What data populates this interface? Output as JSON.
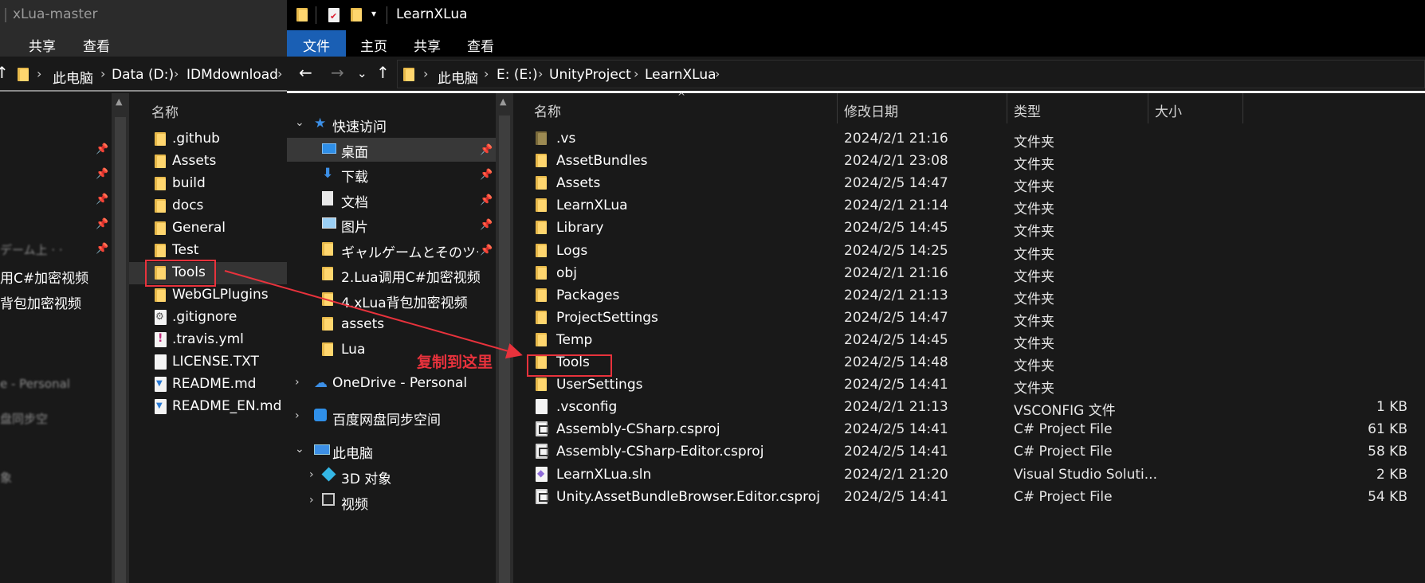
{
  "left_window": {
    "title": "xLua-master",
    "ribbon_tabs": [
      "共享",
      "查看"
    ],
    "address_crumbs": [
      "此电脑",
      "Data (D:)",
      "IDMdownload"
    ],
    "nav_fragments": [
      "用C#加密视频",
      "背包加密视频"
    ],
    "column_name": "名称",
    "items": [
      {
        "name": ".github",
        "kind": "folder"
      },
      {
        "name": "Assets",
        "kind": "folder"
      },
      {
        "name": "build",
        "kind": "folder"
      },
      {
        "name": "docs",
        "kind": "folder"
      },
      {
        "name": "General",
        "kind": "folder"
      },
      {
        "name": "Test",
        "kind": "folder"
      },
      {
        "name": "Tools",
        "kind": "folder"
      },
      {
        "name": "WebGLPlugins",
        "kind": "folder"
      },
      {
        "name": ".gitignore",
        "kind": "git"
      },
      {
        "name": ".travis.yml",
        "kind": "yml"
      },
      {
        "name": "LICENSE.TXT",
        "kind": "file"
      },
      {
        "name": "README.md",
        "kind": "md"
      },
      {
        "name": "README_EN.md",
        "kind": "md"
      }
    ]
  },
  "main_window": {
    "title": "LearnXLua",
    "ribbon_tabs": [
      "文件",
      "主页",
      "共享",
      "查看"
    ],
    "address_crumbs": [
      "此电脑",
      "E: (E:)",
      "UnityProject",
      "LearnXLua"
    ],
    "nav": [
      {
        "label": "快速访问",
        "icon": "star-icon",
        "level": 0,
        "expanded": true
      },
      {
        "label": "桌面",
        "icon": "desktop-icon",
        "level": 1,
        "pinned": true,
        "selected": true
      },
      {
        "label": "下载",
        "icon": "download-icon",
        "level": 1,
        "pinned": true
      },
      {
        "label": "文档",
        "icon": "document-icon",
        "level": 1,
        "pinned": true
      },
      {
        "label": "图片",
        "icon": "picture-icon",
        "level": 1,
        "pinned": true
      },
      {
        "label": "ギャルゲームとそのツー",
        "icon": "folder-icon",
        "level": 1,
        "pinned": true
      },
      {
        "label": "2.Lua调用C#加密视频",
        "icon": "folder-icon",
        "level": 1
      },
      {
        "label": "4.xLua背包加密视频",
        "icon": "folder-icon",
        "level": 1
      },
      {
        "label": "assets",
        "icon": "folder-icon",
        "level": 1
      },
      {
        "label": "Lua",
        "icon": "folder-icon",
        "level": 1
      },
      {
        "label": "OneDrive - Personal",
        "icon": "cloud-icon",
        "level": 0,
        "expanded": false
      },
      {
        "label": "百度网盘同步空间",
        "icon": "baidu-icon",
        "level": 0,
        "expanded": false
      },
      {
        "label": "此电脑",
        "icon": "computer-icon",
        "level": 0,
        "expanded": true
      },
      {
        "label": "3D 对象",
        "icon": "cube-icon",
        "level": 1,
        "expanded": false
      },
      {
        "label": "视频",
        "icon": "video-icon",
        "level": 1,
        "expanded": false
      }
    ],
    "columns": {
      "name": "名称",
      "date": "修改日期",
      "type": "类型",
      "size": "大小"
    },
    "files": [
      {
        "name": ".vs",
        "date": "2024/2/1 21:16",
        "type": "文件夹",
        "size": "",
        "kind": "folder-dark"
      },
      {
        "name": "AssetBundles",
        "date": "2024/2/1 23:08",
        "type": "文件夹",
        "size": "",
        "kind": "folder"
      },
      {
        "name": "Assets",
        "date": "2024/2/5 14:47",
        "type": "文件夹",
        "size": "",
        "kind": "folder"
      },
      {
        "name": "LearnXLua",
        "date": "2024/2/1 21:14",
        "type": "文件夹",
        "size": "",
        "kind": "folder"
      },
      {
        "name": "Library",
        "date": "2024/2/5 14:45",
        "type": "文件夹",
        "size": "",
        "kind": "folder"
      },
      {
        "name": "Logs",
        "date": "2024/2/5 14:25",
        "type": "文件夹",
        "size": "",
        "kind": "folder"
      },
      {
        "name": "obj",
        "date": "2024/2/1 21:16",
        "type": "文件夹",
        "size": "",
        "kind": "folder"
      },
      {
        "name": "Packages",
        "date": "2024/2/1 21:13",
        "type": "文件夹",
        "size": "",
        "kind": "folder"
      },
      {
        "name": "ProjectSettings",
        "date": "2024/2/5 14:47",
        "type": "文件夹",
        "size": "",
        "kind": "folder"
      },
      {
        "name": "Temp",
        "date": "2024/2/5 14:45",
        "type": "文件夹",
        "size": "",
        "kind": "folder"
      },
      {
        "name": "Tools",
        "date": "2024/2/5 14:48",
        "type": "文件夹",
        "size": "",
        "kind": "folder"
      },
      {
        "name": "UserSettings",
        "date": "2024/2/5 14:41",
        "type": "文件夹",
        "size": "",
        "kind": "folder"
      },
      {
        "name": ".vsconfig",
        "date": "2024/2/1 21:13",
        "type": "VSCONFIG 文件",
        "size": "1 KB",
        "kind": "file"
      },
      {
        "name": "Assembly-CSharp.csproj",
        "date": "2024/2/5 14:41",
        "type": "C# Project File",
        "size": "61 KB",
        "kind": "proj"
      },
      {
        "name": "Assembly-CSharp-Editor.csproj",
        "date": "2024/2/5 14:41",
        "type": "C# Project File",
        "size": "58 KB",
        "kind": "proj"
      },
      {
        "name": "LearnXLua.sln",
        "date": "2024/2/1 21:20",
        "type": "Visual Studio Soluti...",
        "size": "2 KB",
        "kind": "sln"
      },
      {
        "name": "Unity.AssetBundleBrowser.Editor.csproj",
        "date": "2024/2/5 14:41",
        "type": "C# Project File",
        "size": "54 KB",
        "kind": "proj"
      }
    ]
  },
  "annotation": {
    "text": "复制到这里",
    "color": "#e8323c"
  },
  "colors": {
    "accent": "#1a5fb4",
    "folder": "#ffd66e",
    "background": "#191919",
    "annotation": "#e8323c"
  }
}
